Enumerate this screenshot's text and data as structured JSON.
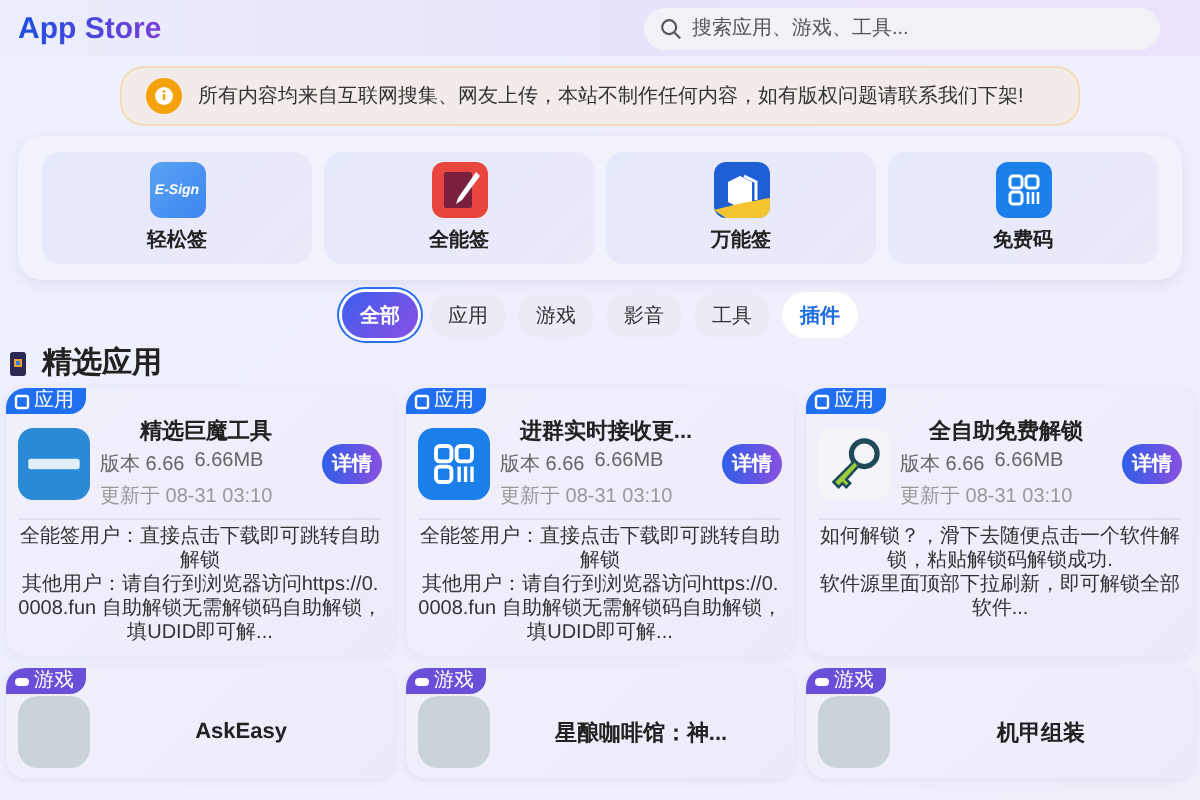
{
  "header": {
    "title": "App Store",
    "search": {
      "placeholder": "搜索应用、游戏、工具..."
    }
  },
  "notice": {
    "text": "所有内容均来自互联网搜集、网友上传，本站不制作任何内容，如有版权问题请联系我们下架!"
  },
  "quick_apps": [
    {
      "name": "轻松签",
      "kind": "esign",
      "logo_text": "E-Sign"
    },
    {
      "name": "全能签",
      "kind": "pen"
    },
    {
      "name": "万能签",
      "kind": "cubes"
    },
    {
      "name": "免费码",
      "kind": "grid"
    }
  ],
  "tabs": [
    {
      "label": "全部",
      "selected": true,
      "highlighted": false
    },
    {
      "label": "应用",
      "selected": false,
      "highlighted": false
    },
    {
      "label": "游戏",
      "selected": false,
      "highlighted": false
    },
    {
      "label": "影音",
      "selected": false,
      "highlighted": false
    },
    {
      "label": "工具",
      "selected": false,
      "highlighted": false
    },
    {
      "label": "插件",
      "selected": false,
      "highlighted": true
    }
  ],
  "section": {
    "title": "精选应用"
  },
  "cards": [
    {
      "tag": {
        "label": "应用",
        "kind": "app"
      },
      "kind": "banner",
      "title": "精选巨魔工具",
      "version": "版本 6.66",
      "size": "6.66MB",
      "updated": "更新于 08-31 03:10",
      "button": "详情",
      "description": [
        "全能签用户：直接点击下载即可跳转自助解锁",
        "其他用户：请自行到浏览器访问https://0.0008.fun 自助解锁无需解锁码自助解锁，填UDID即可解..."
      ]
    },
    {
      "tag": {
        "label": "应用",
        "kind": "app"
      },
      "kind": "grid",
      "title": "进群实时接收更...",
      "version": "版本 6.66",
      "size": "6.66MB",
      "updated": "更新于 08-31 03:10",
      "button": "详情",
      "description": [
        "全能签用户：直接点击下载即可跳转自助解锁",
        "其他用户：请自行到浏览器访问https://0.0008.fun 自助解锁无需解锁码自助解锁，填UDID即可解..."
      ]
    },
    {
      "tag": {
        "label": "应用",
        "kind": "app"
      },
      "kind": "key",
      "title": "全自助免费解锁",
      "version": "版本 6.66",
      "size": "6.66MB",
      "updated": "更新于 08-31 03:10",
      "button": "详情",
      "description": [
        "如何解锁？，滑下去随便点击一个软件解锁，粘贴解锁码解锁成功.",
        "软件源里面顶部下拉刷新，即可解锁全部软件..."
      ]
    },
    {
      "tag": {
        "label": "游戏",
        "kind": "game"
      },
      "kind": "plain",
      "title": "AskEasy"
    },
    {
      "tag": {
        "label": "游戏",
        "kind": "game"
      },
      "kind": "plain",
      "title": "星酿咖啡馆：神..."
    },
    {
      "tag": {
        "label": "游戏",
        "kind": "game"
      },
      "kind": "plain",
      "title": "机甲组装"
    }
  ]
}
